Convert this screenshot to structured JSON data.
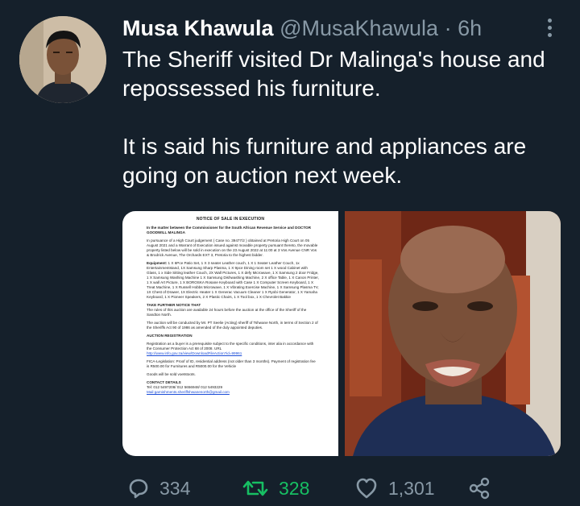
{
  "author": {
    "name": "Musa Khawula",
    "handle": "@MusaKhawula",
    "separator": "·",
    "time": "6h"
  },
  "tweet": {
    "paragraph_1": "The Sheriff visited Dr Malinga's house and repossessed his furniture.",
    "paragraph_2": "It is said his furniture and appliances are going on auction next week."
  },
  "document": {
    "title": "NOTICE OF SALE IN EXECUTION",
    "matter": "In the matter between the Commissioner for the South African Revenue Service and DOCTOR GOODWILL MALINGA",
    "intro": "In pursuance of a High Court judgement ( Case no. 39477/2 ) obtained at Pretoria High Court on 05 August 2021 and a Warrant of Execution issued against movable property pursuant thereto, the movable property listed below will be sold in execution on the 23 August 2022 at 11:00 at 3 Vos Avenue CNR Vos & Brodrick Avenue, The Orchards EXT 3, Pretoria to the highest bidder.",
    "equipment_label": "Equipment:",
    "equipment": "1 X 6Pce Patio Set, 1 X 3 seater Leather couch, 1 X 1 Seater Leather Couch, 1x Entertainmentstand, 1X Samsung Sharp Plasma, 1 X 9pce Dining room set 1 X wood Cabinet with Glass, 1 x Side Sitting leather Couch, 2X Wall Pictures, 1 X defy Microwave, 1 X Samsung 2 door Fridge, 1 X Samsung Washing Machine 1 X Samsung Dishwashing Machine, 2 X office Table, 1 X Canon Printer, 1 X wall Art Picture, 1 X BOROSKA Rosane Keyboard with Case 1 X Computer Screen Keyboard, 1 X Treat Machine, 1 X Russell Hobbs Microwave, 1 X Vibrating Exercise Machine, 1 X Samsung Plasma TV, 1X Chest of Drawer, 1X Electric Heater 1 X Generac Vacuum Cleaner 1 X Ryobi Generator, 1 X Yamaha Keyboard, 1 X Pioneer Speakers, 2 X Plastic Chairs, 1 X Tool box, 1 X Chevrolet Bakkie",
    "notice_heading": "TAKE FURTHER NOTICE THAT",
    "notice": "The rules of this auction are available 24 hours before the auction at the office of the Sheriff of the Sandton North.",
    "conducted": "The auction will be conducted by Mr. PT Seelie (Acting) sheriff of Tshwane North, in terms of Section 2 of the Sheriffs Act 90 of 1986 as amended of the duly appointed deputies.",
    "registration_heading": "AUCTION REGISTRATION",
    "registration": "Registration as a buyer is a prerequisite subject to the specific conditions, inter alia in accordance with the Consumer Protection Act 68 of 2008. URL",
    "registration_link": "http://www.info.gov.za/view/DownloadFileAction?id=99961",
    "fica": "FICA-Legislation: Proof of ID, residential address (not older than 3 months). Payment of registration fee is R500.00 for Furnitures and R5000.00 for the Vehicle",
    "goods": "Goods will be sold voetstoots.",
    "contact_heading": "CONTACT DETAILS",
    "contact_tel": "Tel: 012 5497208/ 012 5656948/ 012 5493229",
    "contact_email": "Mail:garnishments.sheriffshwanenorth@gmail.com"
  },
  "actions": {
    "replies": "334",
    "retweets": "328",
    "likes": "1,301"
  },
  "colors": {
    "background": "#15202b",
    "muted": "#8899a6",
    "retweet": "#17bf63"
  },
  "icons": [
    "reply-icon",
    "retweet-icon",
    "like-icon",
    "share-icon",
    "more-icon"
  ]
}
